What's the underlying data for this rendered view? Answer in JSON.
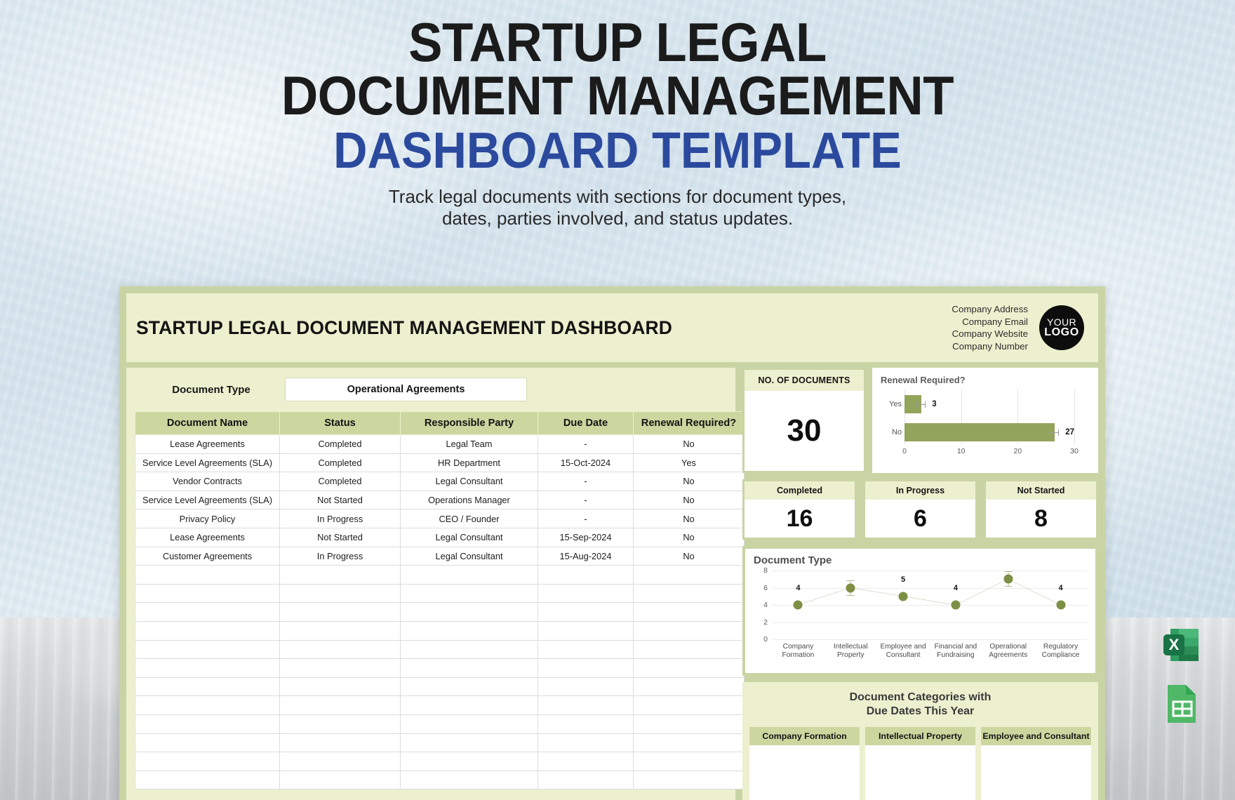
{
  "poster": {
    "title_line1": "STARTUP LEGAL",
    "title_line2": "DOCUMENT MANAGEMENT",
    "title_accent": "DASHBOARD TEMPLATE",
    "subtitle_line1": "Track legal documents with sections for document types,",
    "subtitle_line2": "dates, parties involved, and status updates."
  },
  "colors": {
    "accent_blue": "#2b4a9e",
    "sheet_border": "#c9d4a4",
    "panel_bg": "#edf0cf",
    "header_band": "#ccd69f",
    "bar_green": "#93a45c",
    "point_green": "#7d8f45"
  },
  "dashboard": {
    "title": "STARTUP LEGAL DOCUMENT MANAGEMENT DASHBOARD",
    "company": {
      "address": "Company Address",
      "email": "Company Email",
      "website": "Company Website",
      "number": "Company Number"
    },
    "logo": {
      "line1": "YOUR",
      "line2": "LOGO"
    }
  },
  "filter": {
    "label": "Document Type",
    "selected": "Operational Agreements"
  },
  "table": {
    "headers": [
      "Document Name",
      "Status",
      "Responsible Party",
      "Due Date",
      "Renewal Required?"
    ],
    "rows": [
      [
        "Lease Agreements",
        "Completed",
        "Legal Team",
        "-",
        "No"
      ],
      [
        "Service Level Agreements (SLA)",
        "Completed",
        "HR Department",
        "15-Oct-2024",
        "Yes"
      ],
      [
        "Vendor Contracts",
        "Completed",
        "Legal Consultant",
        "-",
        "No"
      ],
      [
        "Service Level Agreements (SLA)",
        "Not Started",
        "Operations Manager",
        "-",
        "No"
      ],
      [
        "Privacy Policy",
        "In Progress",
        "CEO / Founder",
        "-",
        "No"
      ],
      [
        "Lease Agreements",
        "Not Started",
        "Legal Consultant",
        "15-Sep-2024",
        "No"
      ],
      [
        "Customer Agreements",
        "In Progress",
        "Legal Consultant",
        "15-Aug-2024",
        "No"
      ]
    ],
    "empty_row_count": 12
  },
  "kpis": {
    "no_of_documents": {
      "label": "NO. OF DOCUMENTS",
      "value": "30"
    },
    "completed": {
      "label": "Completed",
      "value": "16"
    },
    "in_progress": {
      "label": "In Progress",
      "value": "6"
    },
    "not_started": {
      "label": "Not Started",
      "value": "8"
    }
  },
  "categories_section": {
    "title_line1": "Document Categories with",
    "title_line2": "Due Dates This Year",
    "columns": [
      "Company Formation",
      "Intellectual Property",
      "Employee and Consultant"
    ]
  },
  "format_icons": {
    "excel": "excel-file-icon",
    "sheets": "google-sheets-file-icon"
  },
  "chart_data": [
    {
      "type": "bar",
      "orientation": "horizontal",
      "title": "Renewal Required?",
      "categories": [
        "Yes",
        "No"
      ],
      "values": [
        3,
        27
      ],
      "data_labels": [
        "3",
        "27"
      ],
      "xlabel": "",
      "ylabel": "",
      "xlim": [
        0,
        30
      ],
      "xticks": [
        0,
        10,
        20,
        30
      ],
      "grid": true,
      "legend": "none",
      "bar_color": "#93a45c"
    },
    {
      "type": "line",
      "title": "Document Type",
      "categories": [
        "Company Formation",
        "Intellectual Property",
        "Employee and Consultant",
        "Financial and Fundraising",
        "Operational Agreements",
        "Regulatory Compliance"
      ],
      "values": [
        4,
        6,
        5,
        4,
        7,
        4
      ],
      "data_labels": [
        "4",
        "",
        "5",
        "4",
        "",
        "4"
      ],
      "xlabel": "",
      "ylabel": "",
      "ylim": [
        0,
        8
      ],
      "yticks": [
        0,
        2,
        4,
        6,
        8
      ],
      "grid": true,
      "legend": "none",
      "line_style": "dashed",
      "marker_color": "#7d8f45"
    }
  ]
}
